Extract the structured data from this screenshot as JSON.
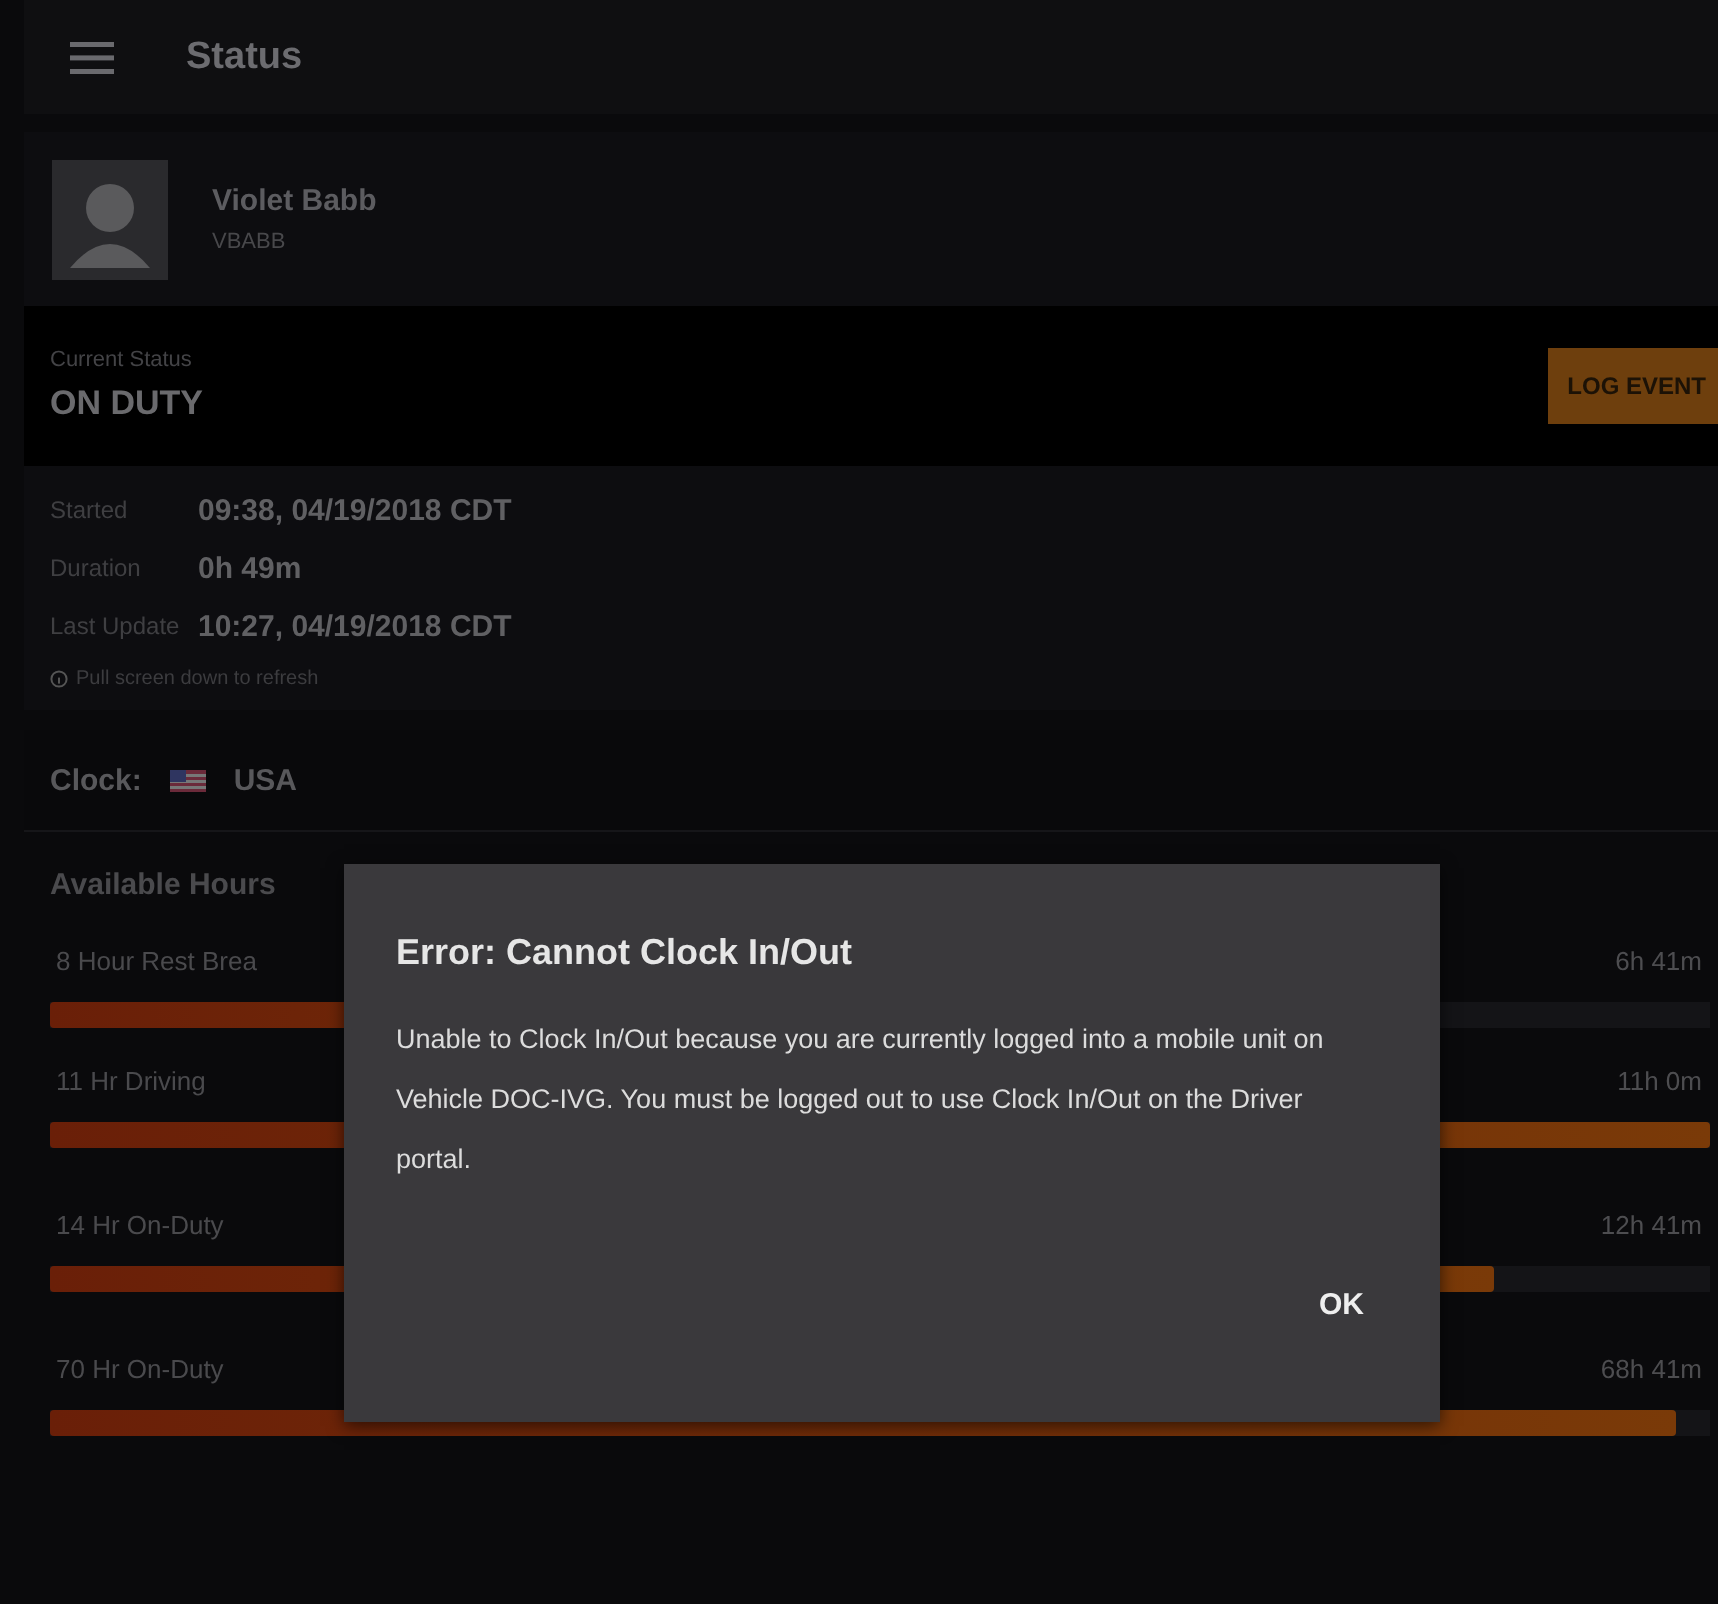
{
  "app_bar": {
    "title": "Status"
  },
  "driver": {
    "name": "Violet Babb",
    "username": "VBABB"
  },
  "current_status": {
    "label": "Current Status",
    "value": "ON DUTY",
    "button": "LOG EVENT"
  },
  "details": [
    {
      "label": "Started",
      "value": "09:38, 04/19/2018 CDT"
    },
    {
      "label": "Duration",
      "value": "0h 49m"
    },
    {
      "label": "Last Update",
      "value": "10:27, 04/19/2018 CDT"
    }
  ],
  "refresh_hint": "Pull screen down to refresh",
  "clock": {
    "label": "Clock:",
    "country": "USA"
  },
  "available_hours": {
    "title": "Available Hours",
    "rows": [
      {
        "name": "8 Hour Rest Brea",
        "remaining": "6h 41m",
        "level": 0.8
      },
      {
        "name": "11 Hr Driving",
        "remaining": "11h 0m",
        "level": 1
      },
      {
        "name": "14 Hr On-Duty",
        "remaining": "12h 41m",
        "level": 0.87
      },
      {
        "name": "70 Hr On-Duty",
        "remaining": "68h 41m",
        "level": 0.98
      }
    ]
  },
  "dialog": {
    "title": "Error: Cannot Clock In/Out",
    "message": "Unable to Clock In/Out because you are currently logged into a mobile unit on Vehicle DOC-IVG. You must be logged out to use Clock In/Out on the Driver portal.",
    "button": "OK"
  }
}
